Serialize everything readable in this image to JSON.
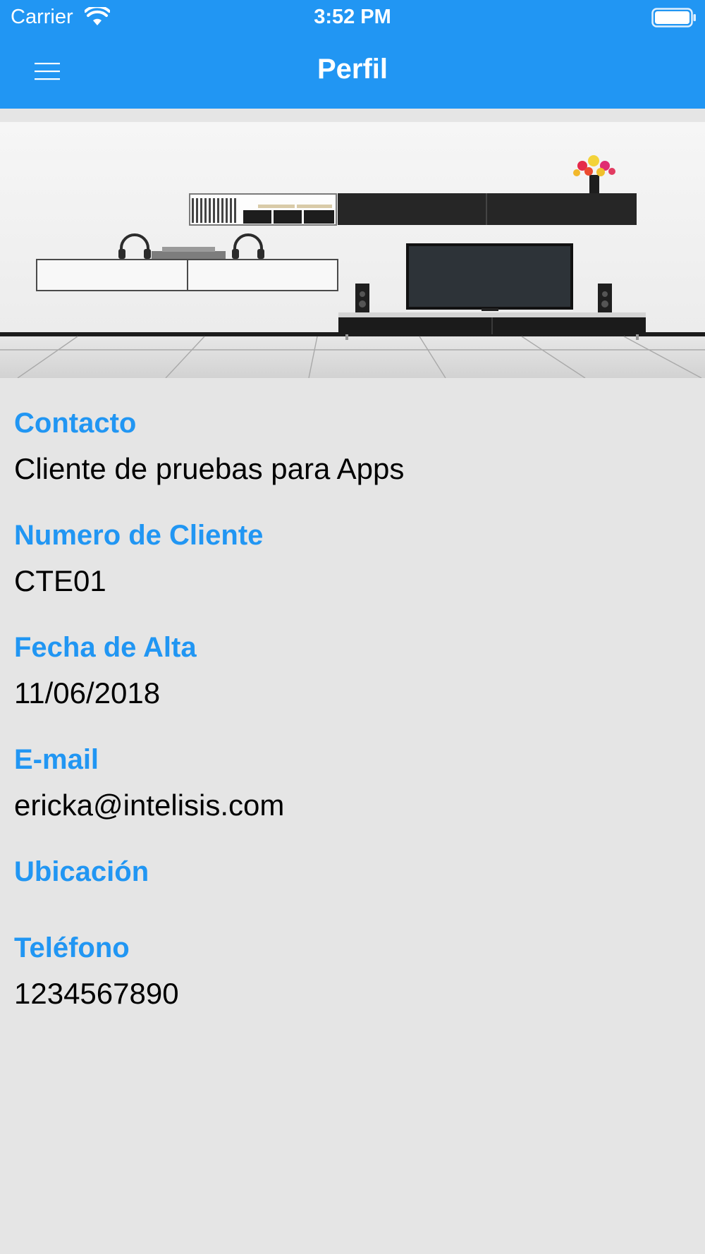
{
  "status_bar": {
    "carrier": "Carrier",
    "time": "3:52 PM",
    "icons": [
      "wifi-icon",
      "battery-icon"
    ]
  },
  "header": {
    "title": "Perfil",
    "menu_icon": "hamburger-menu-icon",
    "background_color": "#2196f3",
    "text_color": "#ffffff"
  },
  "hero_image": {
    "description_icon": "living-room-image"
  },
  "profile": {
    "fields": [
      {
        "label": "Contacto",
        "value": "Cliente de pruebas para Apps"
      },
      {
        "label": "Numero de Cliente",
        "value": "CTE01"
      },
      {
        "label": "Fecha de Alta",
        "value": "11/06/2018"
      },
      {
        "label": "E-mail",
        "value": "ericka@intelisis.com"
      },
      {
        "label": "Ubicación",
        "value": ""
      },
      {
        "label": "Teléfono",
        "value": "1234567890"
      }
    ],
    "label_color": "#2196f3",
    "value_color": "#000000",
    "background_color": "#e5e5e5"
  }
}
